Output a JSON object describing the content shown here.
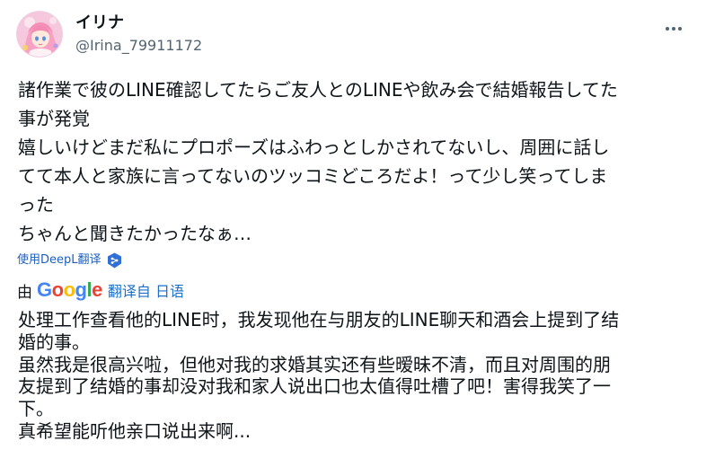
{
  "header": {
    "display_name": "イリナ",
    "handle": "@Irina_79911172"
  },
  "tweet": {
    "lines": [
      "諸作業で彼のLINE確認してたらご友人とのLINEや飲み会で結婚報告してた",
      "事が発覚",
      "嬉しいけどまだ私にプロポーズはふわっとしかされてないし、周囲に話し",
      "てて本人と家族に言ってないのツッコミどころだよ！って少し笑ってしま",
      "った",
      "ちゃんと聞きたかったなぁ…"
    ]
  },
  "translate_link": {
    "label": "使用DeepL翻译"
  },
  "translated_by": {
    "prefix": "由",
    "logo_letters": [
      "G",
      "o",
      "o",
      "g",
      "l",
      "e"
    ],
    "suffix": "翻译自 日语"
  },
  "translation": {
    "lines": [
      "处理工作查看他的LINE时，我发现他在与朋友的LINE聊天和酒会上提到了结",
      "婚的事。",
      "虽然我是很高兴啦，但他对我的求婚其实还有些暧昧不清，而且对周围的朋",
      "友提到了结婚的事却没对我和家人说出口也太值得吐槽了吧！害得我笑了一",
      "下。",
      "真希望能听他亲口说出来啊..."
    ]
  },
  "colors": {
    "text": "#0f1419",
    "secondary": "#536471",
    "link": "#1d5fbf",
    "deepl_badge": "#2f6fd6"
  },
  "icons": {
    "more": "more-horizontal-icon",
    "deepl": "deepl-badge-icon",
    "avatar": "anime-girl-avatar"
  }
}
